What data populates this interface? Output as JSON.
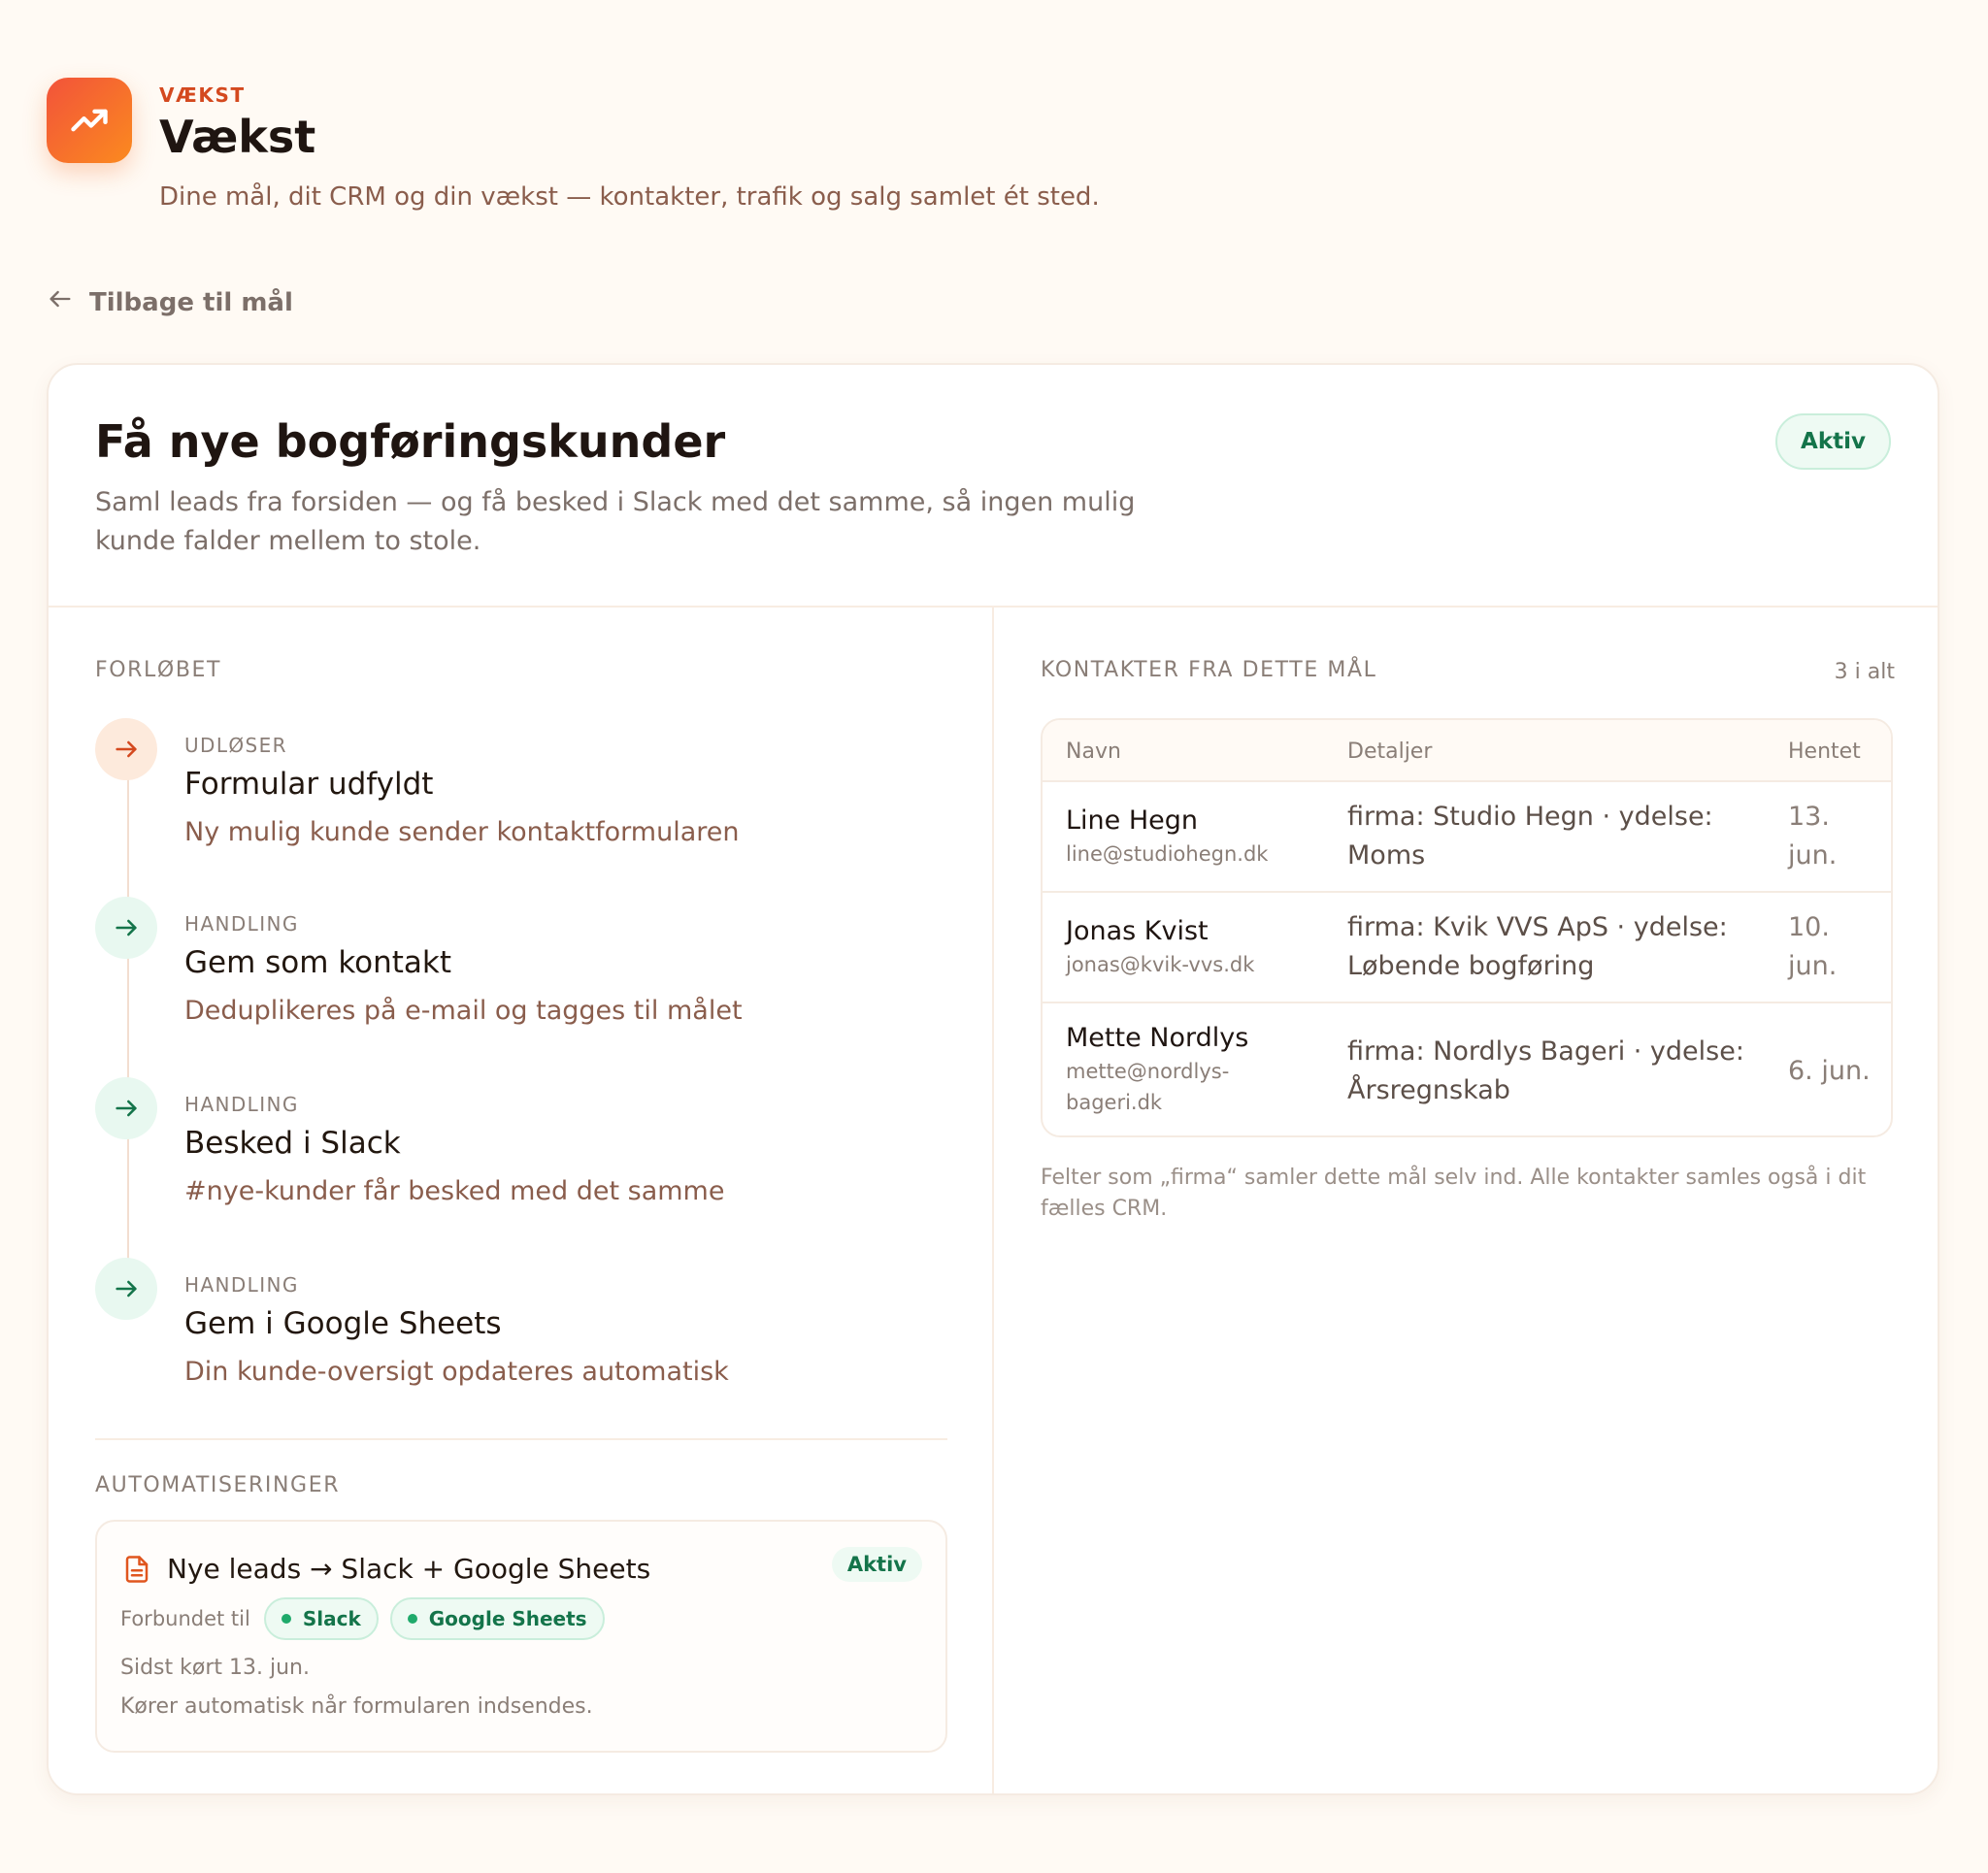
{
  "app": {
    "eyebrow": "VÆKST",
    "title": "Vækst",
    "subtitle": "Dine mål, dit CRM og din vækst — kontakter, trafik og salg samlet ét sted.",
    "icon": "trending-up-icon",
    "accent": "#f2533a"
  },
  "back_link": {
    "label": "Tilbage til mål",
    "icon": "arrow-left-icon"
  },
  "goal": {
    "title": "Få nye bogføringskunder",
    "description": "Saml leads fra forsiden — og få besked i Slack med det samme, så ingen mulig kunde falder mellem to stole.",
    "status": "Aktiv"
  },
  "flow": {
    "heading": "FORLØBET",
    "steps": [
      {
        "kind": "UDLØSER",
        "title": "Formular udfyldt",
        "description": "Ny mulig kunde sender kontaktformularen",
        "icon": "arrow-right-icon"
      },
      {
        "kind": "HANDLING",
        "title": "Gem som kontakt",
        "description": "Deduplikeres på e-mail og tagges til målet",
        "icon": "arrow-right-icon"
      },
      {
        "kind": "HANDLING",
        "title": "Besked i Slack",
        "description": "#nye-kunder får besked med det samme",
        "icon": "arrow-right-icon"
      },
      {
        "kind": "HANDLING",
        "title": "Gem i Google Sheets",
        "description": "Din kunde-oversigt opdateres automatisk",
        "icon": "arrow-right-icon"
      }
    ]
  },
  "automations": {
    "heading": "AUTOMATISERINGER",
    "items": [
      {
        "title": "Nye leads → Slack + Google Sheets",
        "icon": "document-icon",
        "status": "Aktiv",
        "connected_label": "Forbundet til",
        "connections": [
          "Slack",
          "Google Sheets"
        ],
        "last_run": "Sidst kørt 13. jun.",
        "note": "Kører automatisk når formularen indsendes."
      }
    ]
  },
  "contacts": {
    "heading": "KONTAKTER FRA DETTE MÅL",
    "count": "3 i alt",
    "columns": [
      "Navn",
      "Detaljer",
      "Hentet"
    ],
    "rows": [
      {
        "name": "Line Hegn",
        "email": "line@studiohegn.dk",
        "details": "firma: Studio Hegn · ydelse: Moms",
        "date": "13. jun."
      },
      {
        "name": "Jonas Kvist",
        "email": "jonas@kvik-vvs.dk",
        "details": "firma: Kvik VVS ApS · ydelse: Løbende bogføring",
        "date": "10. jun."
      },
      {
        "name": "Mette Nordlys",
        "email": "mette@nordlys-bageri.dk",
        "details": "firma: Nordlys Bageri · ydelse: Årsregnskab",
        "date": "6. jun."
      }
    ],
    "footnote": "Felter som „firma“ samler dette mål selv ind. Alle kontakter samles også i dit fælles CRM."
  }
}
